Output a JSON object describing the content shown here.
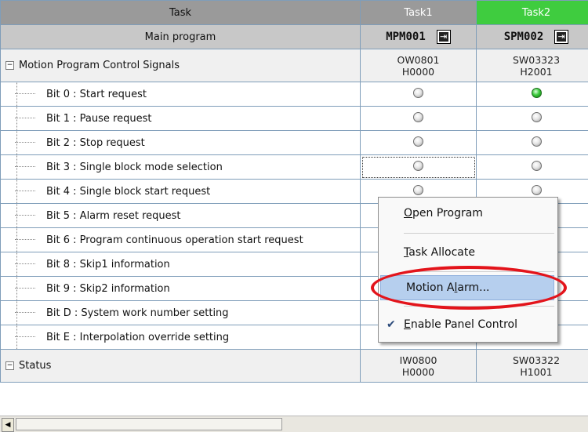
{
  "header": {
    "task_label": "Task",
    "task1": "Task1",
    "task2": "Task2"
  },
  "program_row": {
    "label": "Main program",
    "task1_program": "MPM001",
    "task2_program": "SPM002"
  },
  "colors": {
    "task2_bg": "#3fcc3f",
    "led_on": "#2cc52c",
    "highlight_circle": "#e3141b",
    "menu_highlight": "#b6cfee"
  },
  "groups": [
    {
      "label": "Motion Program Control Signals",
      "task1_reg": "OW0801",
      "task1_val": "H0000",
      "task2_reg": "SW03323",
      "task2_val": "H2001"
    },
    {
      "label": "Status",
      "task1_reg": "IW0800",
      "task1_val": "H0000",
      "task2_reg": "SW03322",
      "task2_val": "H1001"
    }
  ],
  "bits": [
    {
      "label": "Bit 0 : Start request",
      "task1_on": false,
      "task2_on": true
    },
    {
      "label": "Bit 1 : Pause request",
      "task1_on": false,
      "task2_on": false
    },
    {
      "label": "Bit 2 : Stop request",
      "task1_on": false,
      "task2_on": false
    },
    {
      "label": "Bit 3 : Single block mode selection",
      "task1_on": false,
      "task2_on": false
    },
    {
      "label": "Bit 4 : Single block start request",
      "task1_on": false,
      "task2_on": false
    },
    {
      "label": "Bit 5 : Alarm reset request",
      "task1_on": false,
      "task2_on": false
    },
    {
      "label": "Bit 6 : Program continuous operation start request",
      "task1_on": false,
      "task2_on": false
    },
    {
      "label": "Bit 8 : Skip1 information",
      "task1_on": false,
      "task2_on": false
    },
    {
      "label": "Bit 9 : Skip2 information",
      "task1_on": false,
      "task2_on": false
    },
    {
      "label": "Bit D : System work number setting",
      "task1_on": false,
      "task2_on": true
    },
    {
      "label": "Bit E : Interpolation override setting",
      "task1_on": false,
      "task2_on": false
    }
  ],
  "context_menu": {
    "items": [
      {
        "label": "Open Program",
        "mnemonic": "O",
        "rest": "pen Program"
      },
      {
        "label": "Task Allocate",
        "mnemonic": "T",
        "rest": "ask Allocate"
      },
      {
        "label": "Motion Alarm...",
        "before": "Motion A",
        "mnemonic": "l",
        "rest": "arm..."
      },
      {
        "label": "Enable Panel Control",
        "mnemonic": "E",
        "rest": "nable Panel Control",
        "checked": true
      }
    ]
  }
}
